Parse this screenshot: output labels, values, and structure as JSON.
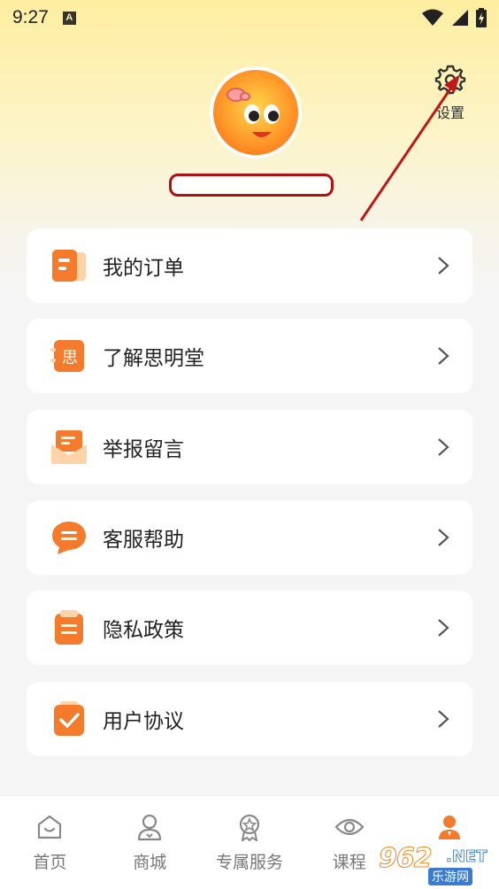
{
  "status_bar": {
    "time": "9:27",
    "notification_letter": "A"
  },
  "settings": {
    "label": "设置",
    "icon": "gear-icon"
  },
  "menu": [
    {
      "label": "我的订单",
      "icon": "order-icon"
    },
    {
      "label": "了解思明堂",
      "icon": "about-icon",
      "icon_char": "思"
    },
    {
      "label": "举报留言",
      "icon": "envelope-icon"
    },
    {
      "label": "客服帮助",
      "icon": "chat-bubble-icon"
    },
    {
      "label": "隐私政策",
      "icon": "clipboard-icon"
    },
    {
      "label": "用户协议",
      "icon": "agreement-check-icon"
    }
  ],
  "bottom_nav": [
    {
      "label": "首页",
      "icon": "home-icon",
      "active": false
    },
    {
      "label": "商城",
      "icon": "shop-icon",
      "active": false
    },
    {
      "label": "专属服务",
      "icon": "badge-icon",
      "active": false
    },
    {
      "label": "课程",
      "icon": "eye-icon",
      "active": false
    },
    {
      "label": "",
      "icon": "user-icon",
      "active": true
    }
  ],
  "watermark": {
    "main": "962",
    "net": ".NET",
    "sub": "乐游网"
  },
  "colors": {
    "accent": "#f47a2c",
    "annotation_red": "#b01010",
    "header_gradient_top": "#fdeea0"
  }
}
